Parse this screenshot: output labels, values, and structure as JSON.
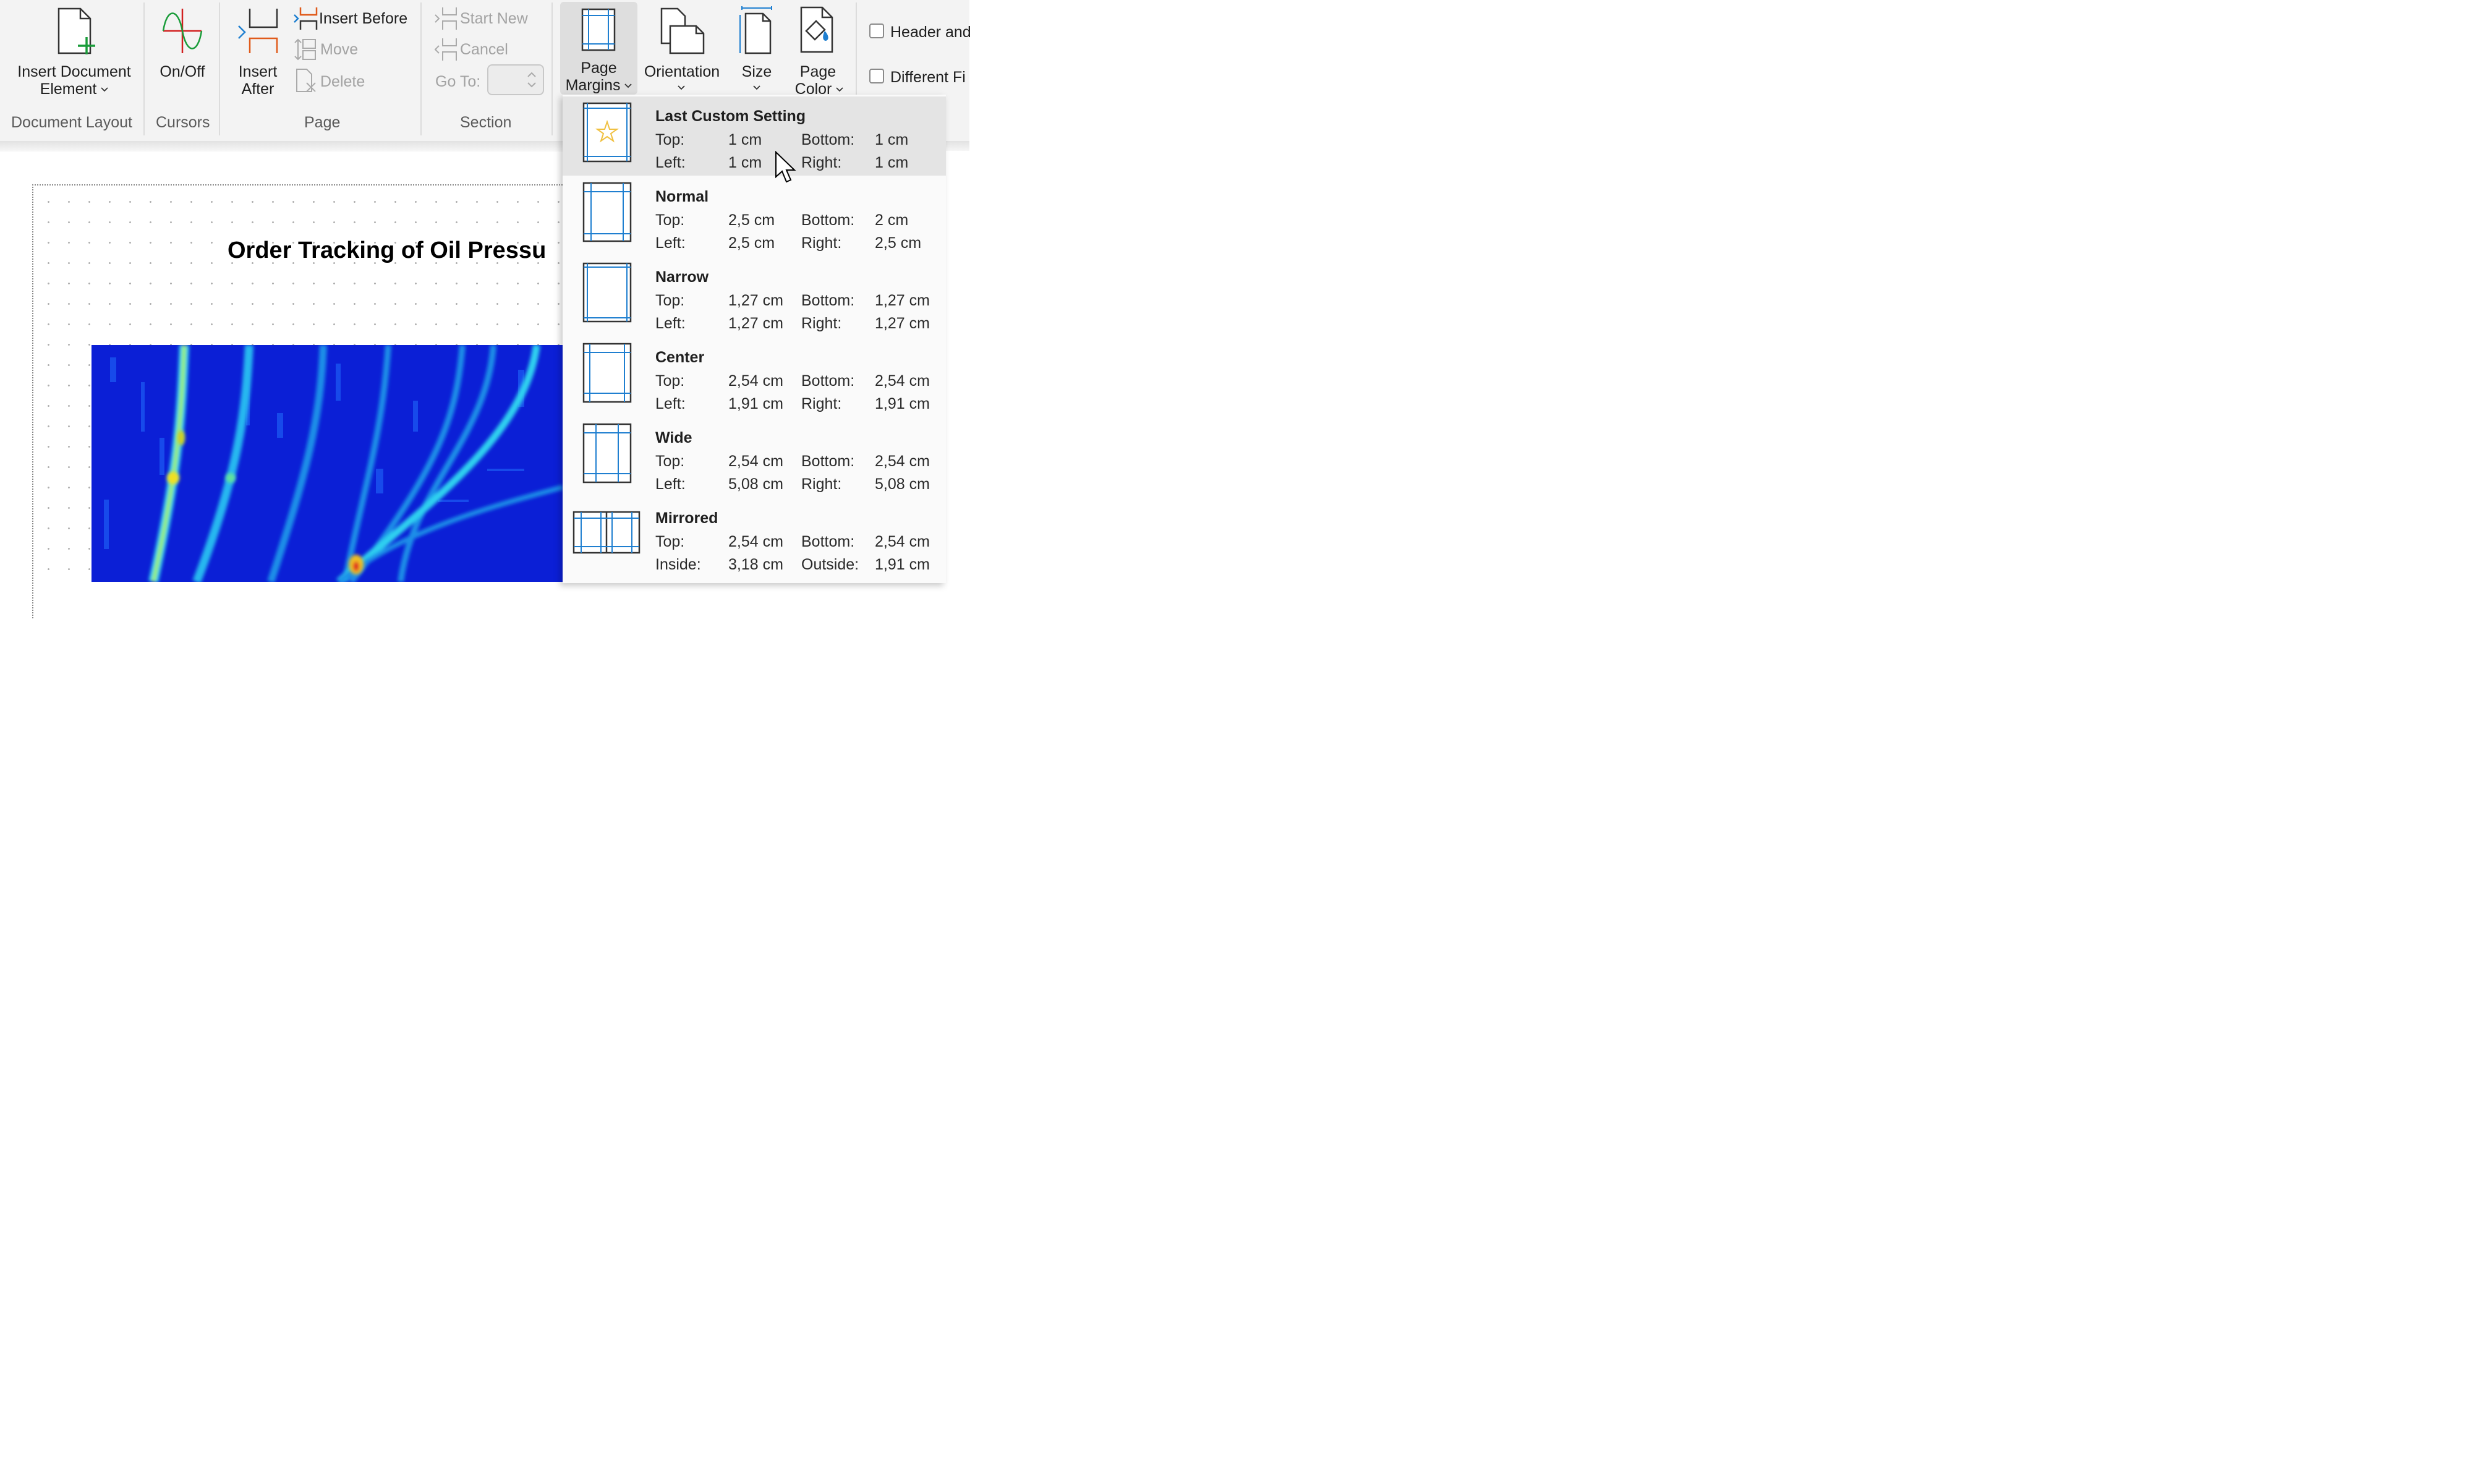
{
  "ribbon": {
    "groups": {
      "document_layout": "Document Layout",
      "cursors": "Cursors",
      "page": "Page",
      "section": "Section"
    },
    "insert_document_element": {
      "line1": "Insert Document",
      "line2": "Element"
    },
    "on_off": "On/Off",
    "insert_after": {
      "line1": "Insert",
      "line2": "After"
    },
    "insert_before": "Insert Before",
    "move": "Move",
    "delete": "Delete",
    "start_new": "Start New",
    "cancel": "Cancel",
    "go_to": "Go To:",
    "page_margins": {
      "line1": "Page",
      "line2": "Margins"
    },
    "orientation": "Orientation",
    "size": "Size",
    "page_color": {
      "line1": "Page",
      "line2": "Color"
    },
    "header_checkbox": "Header and",
    "different_first_checkbox": "Different Fi"
  },
  "document": {
    "chart_title": "Order Tracking of Oil Pressu"
  },
  "margins_menu": {
    "options": [
      {
        "name": "Last Custom Setting",
        "k1": "Top:",
        "v1": "1 cm",
        "k2": "Bottom:",
        "v2": "1 cm",
        "k3": "Left:",
        "v3": "1 cm",
        "k4": "Right:",
        "v4": "1 cm"
      },
      {
        "name": "Normal",
        "k1": "Top:",
        "v1": "2,5 cm",
        "k2": "Bottom:",
        "v2": "2 cm",
        "k3": "Left:",
        "v3": "2,5 cm",
        "k4": "Right:",
        "v4": "2,5 cm"
      },
      {
        "name": "Narrow",
        "k1": "Top:",
        "v1": "1,27 cm",
        "k2": "Bottom:",
        "v2": "1,27 cm",
        "k3": "Left:",
        "v3": "1,27 cm",
        "k4": "Right:",
        "v4": "1,27 cm"
      },
      {
        "name": "Center",
        "k1": "Top:",
        "v1": "2,54 cm",
        "k2": "Bottom:",
        "v2": "2,54 cm",
        "k3": "Left:",
        "v3": "1,91 cm",
        "k4": "Right:",
        "v4": "1,91 cm"
      },
      {
        "name": "Wide",
        "k1": "Top:",
        "v1": "2,54 cm",
        "k2": "Bottom:",
        "v2": "2,54 cm",
        "k3": "Left:",
        "v3": "5,08 cm",
        "k4": "Right:",
        "v4": "5,08 cm"
      },
      {
        "name": "Mirrored",
        "k1": "Top:",
        "v1": "2,54 cm",
        "k2": "Bottom:",
        "v2": "2,54 cm",
        "k3": "Inside:",
        "v3": "3,18 cm",
        "k4": "Outside:",
        "v4": "1,91 cm"
      }
    ]
  },
  "colors": {
    "accent_blue": "#3a96dd",
    "heatmap_background": "#0b1fd6",
    "star": "#f0c040"
  }
}
